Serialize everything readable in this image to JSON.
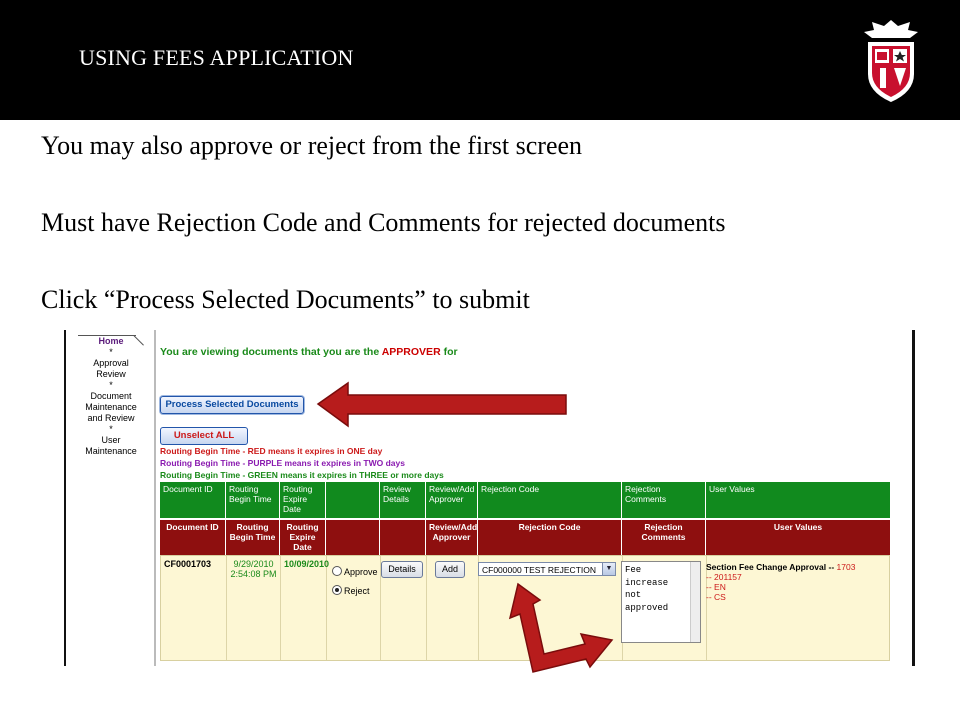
{
  "slide": {
    "title": "USING FEES APPLICATION",
    "bullets": [
      "You may also approve or reject from the first screen",
      "Must have Rejection Code and Comments  for rejected documents",
      "Click “Process Selected Documents”  to submit"
    ],
    "colors": {
      "topbar": "#000000",
      "title_text": "#ffffff",
      "arrow": "#b71c1c"
    }
  },
  "nav": {
    "items": [
      "Home",
      "Approval Review",
      "Document Maintenance and Review",
      "User Maintenance"
    ],
    "separator": "*"
  },
  "main": {
    "heading_prefix": "You are viewing documents that you are the ",
    "heading_role": "APPROVER",
    "heading_suffix": " for",
    "process_button": "Process Selected Documents",
    "unselect_button": "Unselect ALL",
    "legend": [
      {
        "text": "Routing Begin Time - RED means it expires in ONE day",
        "color": "#cc1a1a"
      },
      {
        "text": "Routing Begin Time - PURPLE means it expires in TWO days",
        "color": "#8a1ab0"
      },
      {
        "text": "Routing Begin Time - GREEN means it expires in THREE or more days",
        "color": "#1a8a1a"
      }
    ]
  },
  "table": {
    "green_headers": [
      "Document ID",
      "Routing Begin Time",
      "Routing Expire Date",
      "",
      "Review Details",
      "Review/Add Approver",
      "Rejection Code",
      "Rejection Comments",
      "User Values"
    ],
    "red_headers": [
      "Document ID",
      "Routing Begin Time",
      "Routing Expire Date",
      "",
      "",
      "Review/Add Approver",
      "Rejection Code",
      "Rejection Comments",
      "User Values"
    ],
    "row": {
      "document_id": "CF0001703",
      "begin_date": "9/29/2010",
      "begin_time": "2:54:08 PM",
      "expire_date": "10/09/2010",
      "approve_label": "Approve",
      "reject_label": "Reject",
      "selected": "Reject",
      "details_button": "Details",
      "add_button": "Add",
      "rejection_code": "CF000000 TEST REJECTION",
      "comments_lines": [
        "Fee",
        "increase",
        "not",
        "approved"
      ],
      "user_values": {
        "label": "Section Fee Change Approval -- ",
        "id": "1703",
        "lines": [
          "-- 201157",
          "-- EN",
          "-- CS"
        ]
      }
    }
  }
}
